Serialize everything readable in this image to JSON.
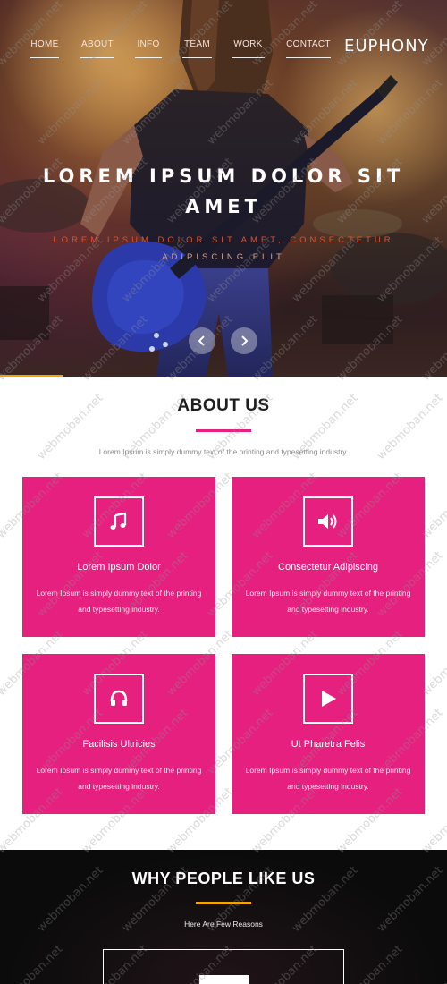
{
  "nav": {
    "items": [
      {
        "label": "HOME"
      },
      {
        "label": "ABOUT"
      },
      {
        "label": "INFO"
      },
      {
        "label": "TEAM"
      },
      {
        "label": "WORK"
      },
      {
        "label": "CONTACT"
      }
    ],
    "brand": "EUPHONY"
  },
  "hero": {
    "title": "LOREM IPSUM DOLOR SIT AMET",
    "subtitle_line1": "LOREM IPSUM DOLOR SIT AMET, CONSECTETUR",
    "subtitle_line2": "ADIPISCING ELIT",
    "prev_icon": "arrow-left-icon",
    "next_icon": "arrow-right-icon"
  },
  "about": {
    "title": "ABOUT US",
    "intro": "Lorem Ipsum is simply dummy text of the printing and typesetting industry.",
    "cards": [
      {
        "icon": "music-note-icon",
        "title": "Lorem Ipsum Dolor",
        "text": "Lorem Ipsum is simply dummy text of the printing and typesetting industry."
      },
      {
        "icon": "speaker-icon",
        "title": "Consectetur Adipiscing",
        "text": "Lorem Ipsum is simply dummy text of the printing and typesetting industry."
      },
      {
        "icon": "headphones-icon",
        "title": "Facilisis Ultricies",
        "text": "Lorem Ipsum is simply dummy text of the printing and typesetting industry."
      },
      {
        "icon": "play-icon",
        "title": "Ut Pharetra Felis",
        "text": "Lorem Ipsum is simply dummy text of the printing and typesetting industry."
      }
    ]
  },
  "why": {
    "title": "WHY PEOPLE LIKE US",
    "subtitle": "Here Are Few Reasons"
  },
  "watermark": "webmoban.net",
  "colors": {
    "card_pink": "#e6207f",
    "accent_orange": "#f0a500",
    "dark_section": "#0b0b0b"
  }
}
